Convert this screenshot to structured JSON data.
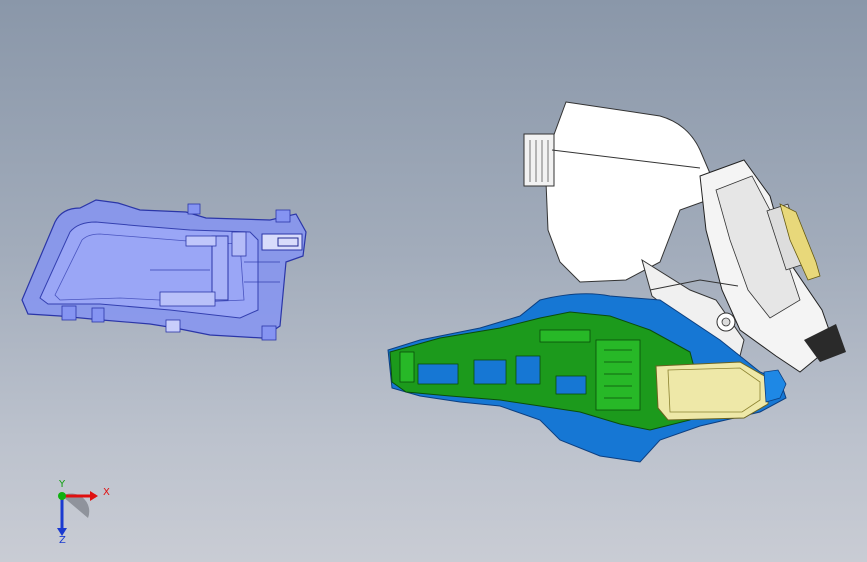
{
  "viewport": {
    "background_top": "#8a97a9",
    "background_bottom": "#c9ccd4"
  },
  "parts": {
    "handle_bezel": {
      "color": "#7f8ef2",
      "icon": "inner-door-handle-bezel"
    },
    "outer_handle_frame": {
      "colors": [
        "#1a8a1a",
        "#1677d4",
        "#e6e0a0"
      ],
      "icon": "outer-handle-carrier"
    },
    "latch_assembly": {
      "colors": [
        "#ffffff",
        "#d9d9d9"
      ],
      "icon": "door-latch-module"
    }
  },
  "triad": {
    "x_label": "X",
    "y_label": "Y",
    "z_label": "Z",
    "x_color": "#e01010",
    "y_color": "#10b010",
    "z_color": "#1a3ad0"
  }
}
